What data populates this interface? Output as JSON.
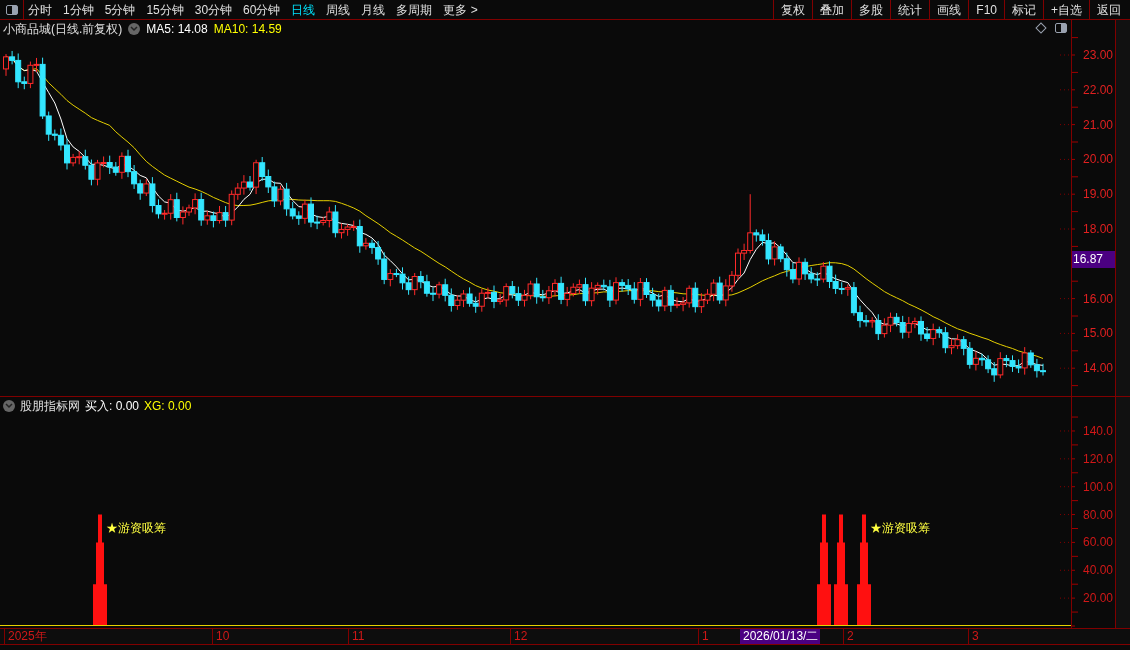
{
  "toolbar": {
    "tabs": [
      {
        "label": "分时",
        "selected": false
      },
      {
        "label": "1分钟",
        "selected": false
      },
      {
        "label": "5分钟",
        "selected": false
      },
      {
        "label": "15分钟",
        "selected": false
      },
      {
        "label": "30分钟",
        "selected": false
      },
      {
        "label": "60分钟",
        "selected": false
      },
      {
        "label": "日线",
        "selected": true
      },
      {
        "label": "周线",
        "selected": false
      },
      {
        "label": "月线",
        "selected": false
      },
      {
        "label": "多周期",
        "selected": false
      },
      {
        "label": "更多 >",
        "selected": false
      }
    ],
    "buttons": [
      "复权",
      "叠加",
      "多股",
      "统计",
      "画线",
      "F10",
      "标记",
      "+自选",
      "返回"
    ]
  },
  "price_panel": {
    "title": "小商品城(日线.前复权)",
    "legend": [
      {
        "text": "MA5: 14.08",
        "color": "#ffffff"
      },
      {
        "text": "MA10: 14.59",
        "color": "#ffff00"
      }
    ],
    "axis_labels": [
      "23.00",
      "22.00",
      "21.00",
      "20.00",
      "19.00",
      "18.00",
      "16.00",
      "15.00",
      "14.00"
    ],
    "price_tag": "16.87"
  },
  "indicator_panel": {
    "title": "股朋指标网",
    "legend": [
      {
        "text": "买入: 0.00",
        "kind": "plain"
      },
      {
        "text": "XG: 0.00",
        "kind": "signal"
      }
    ],
    "axis_labels": [
      "140.0",
      "120.0",
      "100.0",
      "80.00",
      "60.00",
      "40.00",
      "20.00"
    ],
    "annotations": [
      "★游资吸筹",
      "★游资吸筹"
    ]
  },
  "time_axis": {
    "labels": [
      {
        "text": "2025年",
        "selected": false
      },
      {
        "text": "10",
        "selected": false
      },
      {
        "text": "11",
        "selected": false
      },
      {
        "text": "12",
        "selected": false
      },
      {
        "text": "1",
        "selected": false
      },
      {
        "text": "2026/01/13/二",
        "selected": true
      },
      {
        "text": "2",
        "selected": false
      },
      {
        "text": "3",
        "selected": false
      }
    ]
  }
}
